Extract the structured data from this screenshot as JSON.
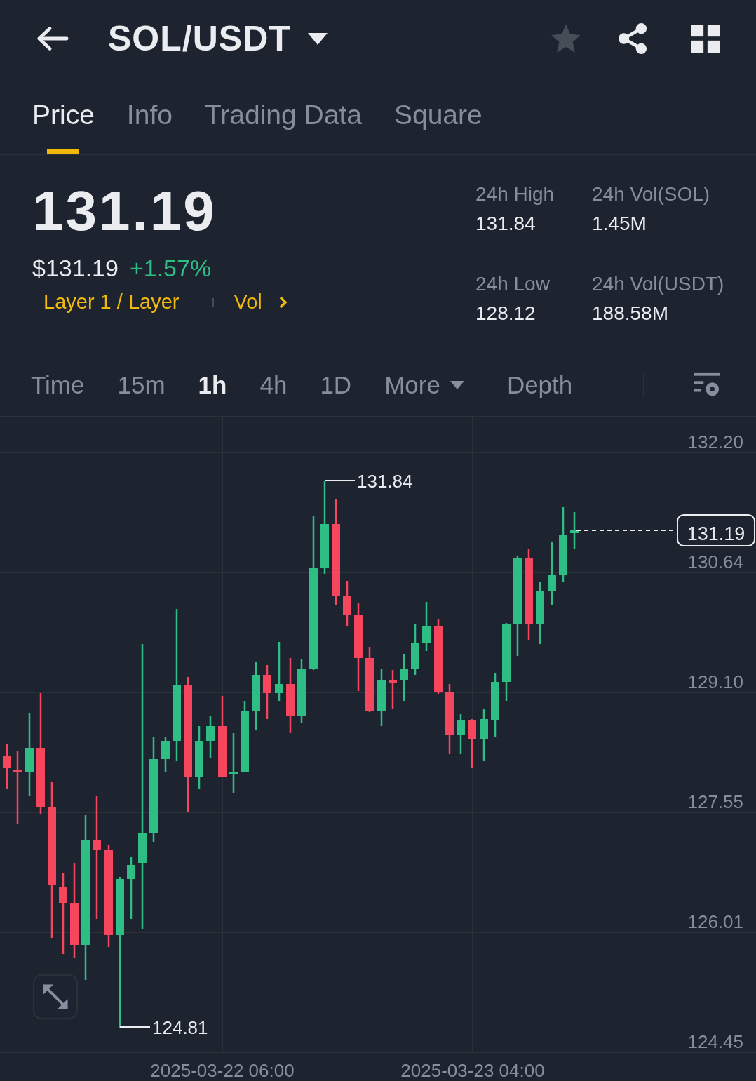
{
  "header": {
    "pair": "SOL/USDT",
    "favorite": false
  },
  "tabs": [
    {
      "label": "Price",
      "selected": true
    },
    {
      "label": "Info",
      "selected": false
    },
    {
      "label": "Trading Data",
      "selected": false
    },
    {
      "label": "Square",
      "selected": false
    }
  ],
  "price": {
    "last": "131.19",
    "usd": "$131.19",
    "change": "+1.57%",
    "tags": [
      "Layer 1 / Layer",
      "Vol"
    ]
  },
  "stats": [
    {
      "label": "24h High",
      "value": "131.84"
    },
    {
      "label": "24h Vol(SOL)",
      "value": "1.45M"
    },
    {
      "label": "24h Low",
      "value": "128.12"
    },
    {
      "label": "24h Vol(USDT)",
      "value": "188.58M"
    }
  ],
  "intervals": [
    {
      "label": "Time",
      "kind": "interval",
      "selected": false
    },
    {
      "label": "15m",
      "kind": "interval",
      "selected": false
    },
    {
      "label": "1h",
      "kind": "interval",
      "selected": true
    },
    {
      "label": "4h",
      "kind": "interval",
      "selected": false
    },
    {
      "label": "1D",
      "kind": "interval",
      "selected": false
    },
    {
      "label": "More",
      "kind": "dropdown",
      "selected": false
    },
    {
      "label": "Depth",
      "kind": "interval",
      "selected": false
    }
  ],
  "chart": {
    "y_labels": [
      "132.20",
      "130.64",
      "129.10",
      "127.55",
      "126.01",
      "124.45"
    ],
    "high_marker": "131.84",
    "low_marker": "124.81",
    "current_price": "131.19",
    "x_labels": [
      "2025-03-22 06:00",
      "2025-03-23 04:00"
    ]
  }
}
